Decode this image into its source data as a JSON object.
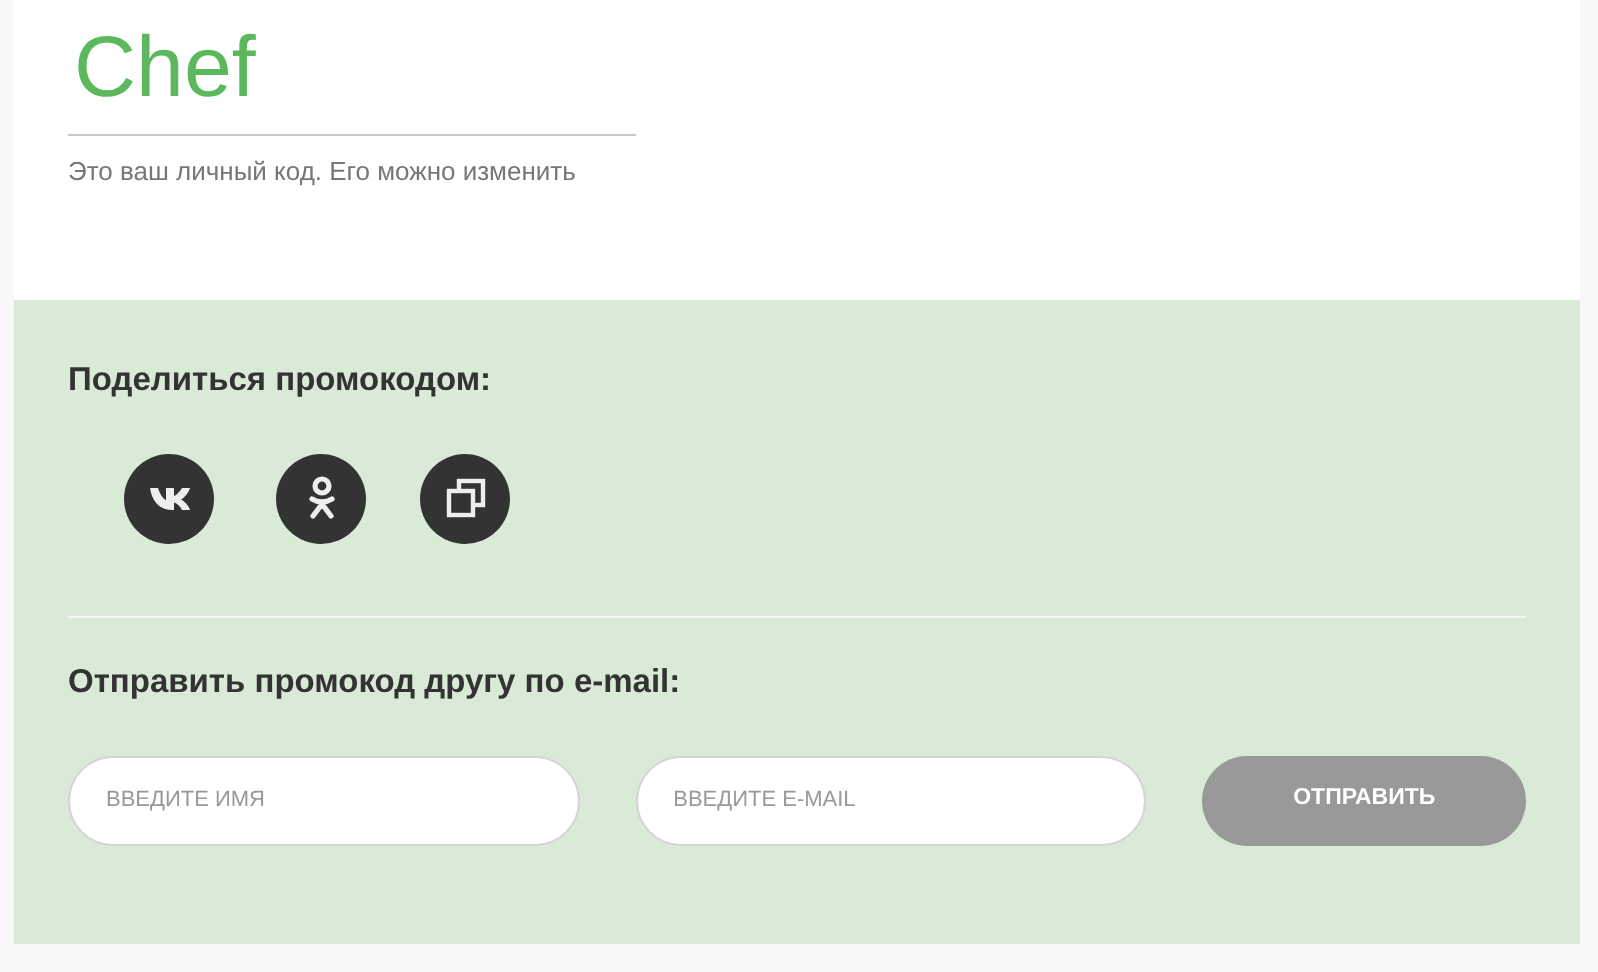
{
  "promo": {
    "code": "Chef",
    "caption": "Это ваш личный код. Его можно изменить"
  },
  "share": {
    "heading": "Поделиться промокодом:",
    "buttons": [
      {
        "kind": "vk"
      },
      {
        "kind": "ok"
      },
      {
        "kind": "copy"
      }
    ]
  },
  "email_form": {
    "heading": "Отправить промокод другу по e-mail:",
    "name_field": {
      "placeholder": "ВВЕДИТЕ ИМЯ"
    },
    "email_field": {
      "placeholder": "ВВЕДИТЕ E-MAIL"
    },
    "submit": "ОТПРАВИТЬ"
  }
}
